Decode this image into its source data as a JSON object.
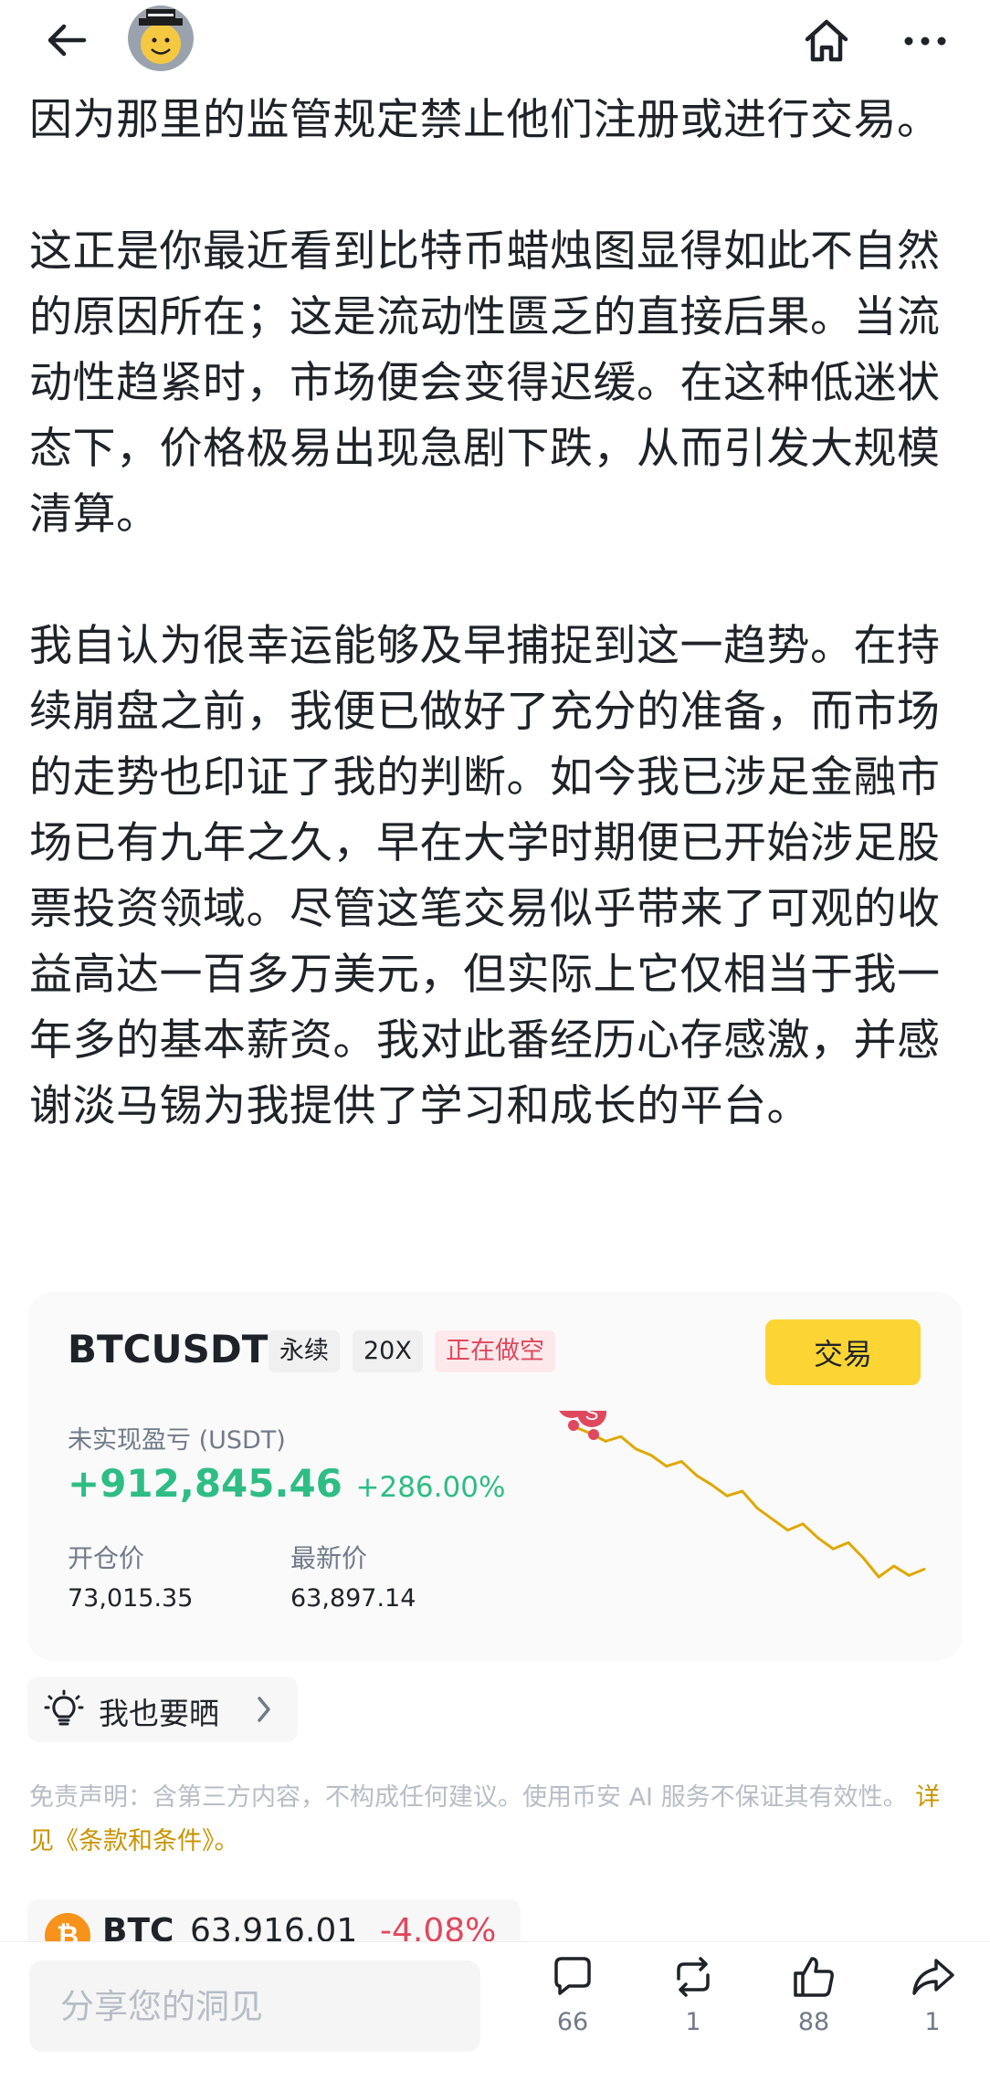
{
  "header": {
    "back_icon": "arrow-left-icon",
    "avatar_icon": "smiley-avatar-icon",
    "home_icon": "home-icon",
    "more_icon": "more-dots-icon"
  },
  "article": {
    "paragraphs": [
      "因为那里的监管规定禁止他们注册或进行交易。",
      "这正是你最近看到比特币蜡烛图显得如此不自然的原因所在；这是流动性匮乏的直接后果。当流动性趋紧时，市场便会变得迟缓。在这种低迷状态下，价格极易出现急剧下跌，从而引发大规模清算。",
      "我自认为很幸运能够及早捕捉到这一趋势。在持续崩盘之前，我便已做好了充分的准备，而市场的走势也印证了我的判断。如今我已涉足金融市场已有九年之久，早在大学时期便已开始涉足股票投资领域。尽管这笔交易似乎带来了可观的收益高达一百多万美元，但实际上它仅相当于我一年多的基本薪资。我对此番经历心存感激，并感谢淡马锡为我提供了学习和成长的平台。"
    ]
  },
  "position_card": {
    "symbol": "BTCUSDT",
    "tag_perpetual": "永续",
    "tag_leverage": "20X",
    "tag_status": "正在做空",
    "trade_button": "交易",
    "pnl_label": "未实现盈亏 (USDT)",
    "pnl_value": "+912,845.46",
    "pnl_percent": "+286.00%",
    "entry_label": "开仓价",
    "entry_value": "73,015.35",
    "last_label": "最新价",
    "last_value": "63,897.14",
    "marker_text": "S",
    "colors": {
      "profit": "#2ebd85",
      "short": "#e0485d",
      "line": "#e0a800",
      "button": "#fcd535"
    }
  },
  "chart_data": {
    "type": "line",
    "series": [
      {
        "values": [
          73.0,
          72.6,
          72.1,
          72.4,
          71.6,
          71.2,
          70.5,
          70.8,
          69.9,
          69.3,
          68.6,
          68.9,
          67.8,
          67.1,
          66.4,
          66.8,
          65.9,
          65.2,
          65.6,
          64.6,
          63.4,
          64.1,
          63.5,
          63.9
        ]
      }
    ],
    "markers": [
      "S",
      "S"
    ],
    "grid": false
  },
  "share_chip": {
    "label": "我也要晒",
    "icon": "lightbulb-icon"
  },
  "disclaimer": {
    "text": "免责声明：含第三方内容，不构成任何建议。使用币安 AI 服务不保证其有效性。",
    "link": "详见《条款和条件》。"
  },
  "ticker": {
    "symbol": "BTC",
    "price": "63,916.01",
    "change": "-4.08%",
    "icon": "bitcoin-icon"
  },
  "bottom_bar": {
    "input_placeholder": "分享您的洞见",
    "comment_count": "66",
    "repost_count": "1",
    "like_count": "88",
    "share_count": "1"
  }
}
